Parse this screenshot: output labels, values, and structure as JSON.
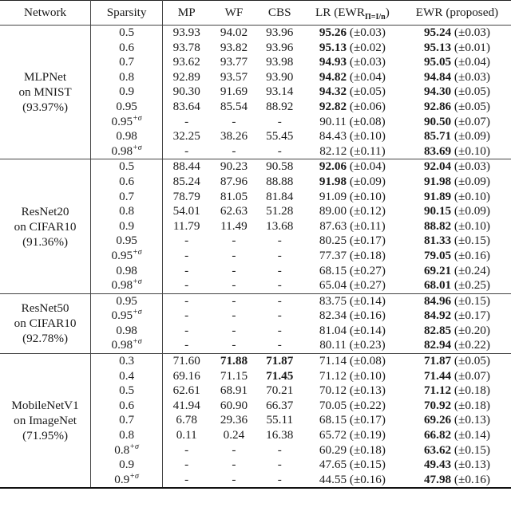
{
  "header": {
    "network": "Network",
    "sparsity": "Sparsity",
    "mp": "MP",
    "wf": "WF",
    "cbs": "CBS",
    "lr_prefix": "LR (EWR",
    "lr_sub": "Π=I/n",
    "lr_suffix": ")",
    "ewr": "EWR (proposed)"
  },
  "groups": [
    {
      "network": [
        "MLPNet",
        "on MNIST",
        "(93.97%)"
      ],
      "rows": [
        {
          "sp": "0.5",
          "sigma": false,
          "mp": "93.93",
          "wf": "94.02",
          "cbs": "93.96",
          "lr": "95.26",
          "lr_pm": "(±0.03)",
          "lr_bold": true,
          "ewr": "95.24",
          "ewr_pm": "(±0.03)",
          "ewr_bold": true
        },
        {
          "sp": "0.6",
          "sigma": false,
          "mp": "93.78",
          "wf": "93.82",
          "cbs": "93.96",
          "lr": "95.13",
          "lr_pm": "(±0.02)",
          "lr_bold": true,
          "ewr": "95.13",
          "ewr_pm": "(±0.01)",
          "ewr_bold": true
        },
        {
          "sp": "0.7",
          "sigma": false,
          "mp": "93.62",
          "wf": "93.77",
          "cbs": "93.98",
          "lr": "94.93",
          "lr_pm": "(±0.03)",
          "lr_bold": true,
          "ewr": "95.05",
          "ewr_pm": "(±0.04)",
          "ewr_bold": true
        },
        {
          "sp": "0.8",
          "sigma": false,
          "mp": "92.89",
          "wf": "93.57",
          "cbs": "93.90",
          "lr": "94.82",
          "lr_pm": "(±0.04)",
          "lr_bold": true,
          "ewr": "94.84",
          "ewr_pm": "(±0.03)",
          "ewr_bold": true
        },
        {
          "sp": "0.9",
          "sigma": false,
          "mp": "90.30",
          "wf": "91.69",
          "cbs": "93.14",
          "lr": "94.32",
          "lr_pm": "(±0.05)",
          "lr_bold": true,
          "ewr": "94.30",
          "ewr_pm": "(±0.05)",
          "ewr_bold": true
        },
        {
          "sp": "0.95",
          "sigma": false,
          "mp": "83.64",
          "wf": "85.54",
          "cbs": "88.92",
          "lr": "92.82",
          "lr_pm": "(±0.06)",
          "lr_bold": true,
          "ewr": "92.86",
          "ewr_pm": "(±0.05)",
          "ewr_bold": true
        },
        {
          "sp": "0.95",
          "sigma": true,
          "mp": "-",
          "wf": "-",
          "cbs": "-",
          "lr": "90.11",
          "lr_pm": "(±0.08)",
          "lr_bold": false,
          "ewr": "90.50",
          "ewr_pm": "(±0.07)",
          "ewr_bold": true
        },
        {
          "sp": "0.98",
          "sigma": false,
          "mp": "32.25",
          "wf": "38.26",
          "cbs": "55.45",
          "lr": "84.43",
          "lr_pm": "(±0.10)",
          "lr_bold": false,
          "ewr": "85.71",
          "ewr_pm": "(±0.09)",
          "ewr_bold": true
        },
        {
          "sp": "0.98",
          "sigma": true,
          "mp": "-",
          "wf": "-",
          "cbs": "-",
          "lr": "82.12",
          "lr_pm": "(±0.11)",
          "lr_bold": false,
          "ewr": "83.69",
          "ewr_pm": "(±0.10)",
          "ewr_bold": true
        }
      ]
    },
    {
      "network": [
        "ResNet20",
        "on CIFAR10",
        "(91.36%)"
      ],
      "rows": [
        {
          "sp": "0.5",
          "sigma": false,
          "mp": "88.44",
          "wf": "90.23",
          "cbs": "90.58",
          "lr": "92.06",
          "lr_pm": "(±0.04)",
          "lr_bold": true,
          "ewr": "92.04",
          "ewr_pm": "(±0.03)",
          "ewr_bold": true
        },
        {
          "sp": "0.6",
          "sigma": false,
          "mp": "85.24",
          "wf": "87.96",
          "cbs": "88.88",
          "lr": "91.98",
          "lr_pm": "(±0.09)",
          "lr_bold": true,
          "ewr": "91.98",
          "ewr_pm": "(±0.09)",
          "ewr_bold": true
        },
        {
          "sp": "0.7",
          "sigma": false,
          "mp": "78.79",
          "wf": "81.05",
          "cbs": "81.84",
          "lr": "91.09",
          "lr_pm": "(±0.10)",
          "lr_bold": false,
          "ewr": "91.89",
          "ewr_pm": "(±0.10)",
          "ewr_bold": true
        },
        {
          "sp": "0.8",
          "sigma": false,
          "mp": "54.01",
          "wf": "62.63",
          "cbs": "51.28",
          "lr": "89.00",
          "lr_pm": "(±0.12)",
          "lr_bold": false,
          "ewr": "90.15",
          "ewr_pm": "(±0.09)",
          "ewr_bold": true
        },
        {
          "sp": "0.9",
          "sigma": false,
          "mp": "11.79",
          "wf": "11.49",
          "cbs": "13.68",
          "lr": "87.63",
          "lr_pm": "(±0.11)",
          "lr_bold": false,
          "ewr": "88.82",
          "ewr_pm": "(±0.10)",
          "ewr_bold": true
        },
        {
          "sp": "0.95",
          "sigma": false,
          "mp": "-",
          "wf": "-",
          "cbs": "-",
          "lr": "80.25",
          "lr_pm": "(±0.17)",
          "lr_bold": false,
          "ewr": "81.33",
          "ewr_pm": "(±0.15)",
          "ewr_bold": true
        },
        {
          "sp": "0.95",
          "sigma": true,
          "mp": "-",
          "wf": "-",
          "cbs": "-",
          "lr": "77.37",
          "lr_pm": "(±0.18)",
          "lr_bold": false,
          "ewr": "79.05",
          "ewr_pm": "(±0.16)",
          "ewr_bold": true
        },
        {
          "sp": "0.98",
          "sigma": false,
          "mp": "-",
          "wf": "-",
          "cbs": "-",
          "lr": "68.15",
          "lr_pm": "(±0.27)",
          "lr_bold": false,
          "ewr": "69.21",
          "ewr_pm": "(±0.24)",
          "ewr_bold": true
        },
        {
          "sp": "0.98",
          "sigma": true,
          "mp": "-",
          "wf": "-",
          "cbs": "-",
          "lr": "65.04",
          "lr_pm": "(±0.27)",
          "lr_bold": false,
          "ewr": "68.01",
          "ewr_pm": "(±0.25)",
          "ewr_bold": true
        }
      ]
    },
    {
      "network": [
        "ResNet50",
        "on CIFAR10",
        "(92.78%)"
      ],
      "rows": [
        {
          "sp": "0.95",
          "sigma": false,
          "mp": "-",
          "wf": "-",
          "cbs": "-",
          "lr": "83.75",
          "lr_pm": "(±0.14)",
          "lr_bold": false,
          "ewr": "84.96",
          "ewr_pm": "(±0.15)",
          "ewr_bold": true
        },
        {
          "sp": "0.95",
          "sigma": true,
          "mp": "-",
          "wf": "-",
          "cbs": "-",
          "lr": "82.34",
          "lr_pm": "(±0.16)",
          "lr_bold": false,
          "ewr": "84.92",
          "ewr_pm": "(±0.17)",
          "ewr_bold": true
        },
        {
          "sp": "0.98",
          "sigma": false,
          "mp": "-",
          "wf": "-",
          "cbs": "-",
          "lr": "81.04",
          "lr_pm": "(±0.14)",
          "lr_bold": false,
          "ewr": "82.85",
          "ewr_pm": "(±0.20)",
          "ewr_bold": true
        },
        {
          "sp": "0.98",
          "sigma": true,
          "mp": "-",
          "wf": "-",
          "cbs": "-",
          "lr": "80.11",
          "lr_pm": "(±0.23)",
          "lr_bold": false,
          "ewr": "82.94",
          "ewr_pm": "(±0.22)",
          "ewr_bold": true
        }
      ]
    },
    {
      "network": [
        "MobileNetV1",
        "on ImageNet",
        "(71.95%)"
      ],
      "rows": [
        {
          "sp": "0.3",
          "sigma": false,
          "mp": "71.60",
          "wf": "71.88",
          "wf_bold": true,
          "cbs": "71.87",
          "cbs_bold": true,
          "lr": "71.14",
          "lr_pm": "(±0.08)",
          "lr_bold": false,
          "ewr": "71.87",
          "ewr_pm": "(±0.05)",
          "ewr_bold": true
        },
        {
          "sp": "0.4",
          "sigma": false,
          "mp": "69.16",
          "wf": "71.15",
          "cbs": "71.45",
          "cbs_bold": true,
          "lr": "71.12",
          "lr_pm": "(±0.10)",
          "lr_bold": false,
          "ewr": "71.44",
          "ewr_pm": "(±0.07)",
          "ewr_bold": true
        },
        {
          "sp": "0.5",
          "sigma": false,
          "mp": "62.61",
          "wf": "68.91",
          "cbs": "70.21",
          "lr": "70.12",
          "lr_pm": "(±0.13)",
          "lr_bold": false,
          "ewr": "71.12",
          "ewr_pm": "(±0.18)",
          "ewr_bold": true
        },
        {
          "sp": "0.6",
          "sigma": false,
          "mp": "41.94",
          "wf": "60.90",
          "cbs": "66.37",
          "lr": "70.05",
          "lr_pm": "(±0.22)",
          "lr_bold": false,
          "ewr": "70.92",
          "ewr_pm": "(±0.18)",
          "ewr_bold": true
        },
        {
          "sp": "0.7",
          "sigma": false,
          "mp": "6.78",
          "wf": "29.36",
          "cbs": "55.11",
          "lr": "68.15",
          "lr_pm": "(±0.17)",
          "lr_bold": false,
          "ewr": "69.26",
          "ewr_pm": "(±0.13)",
          "ewr_bold": true
        },
        {
          "sp": "0.8",
          "sigma": false,
          "mp": "0.11",
          "wf": "0.24",
          "cbs": "16.38",
          "lr": "65.72",
          "lr_pm": "(±0.19)",
          "lr_bold": false,
          "ewr": "66.82",
          "ewr_pm": "(±0.14)",
          "ewr_bold": true
        },
        {
          "sp": "0.8",
          "sigma": true,
          "mp": "-",
          "wf": "-",
          "cbs": "-",
          "lr": "60.29",
          "lr_pm": "(±0.18)",
          "lr_bold": false,
          "ewr": "63.62",
          "ewr_pm": "(±0.15)",
          "ewr_bold": true
        },
        {
          "sp": "0.9",
          "sigma": false,
          "mp": "-",
          "wf": "-",
          "cbs": "-",
          "lr": "47.65",
          "lr_pm": "(±0.15)",
          "lr_bold": false,
          "ewr": "49.43",
          "ewr_pm": "(±0.13)",
          "ewr_bold": true
        },
        {
          "sp": "0.9",
          "sigma": true,
          "mp": "-",
          "wf": "-",
          "cbs": "-",
          "lr": "44.55",
          "lr_pm": "(±0.16)",
          "lr_bold": false,
          "ewr": "47.98",
          "ewr_pm": "(±0.16)",
          "ewr_bold": true
        }
      ]
    }
  ],
  "sigma_mark": "+σ"
}
